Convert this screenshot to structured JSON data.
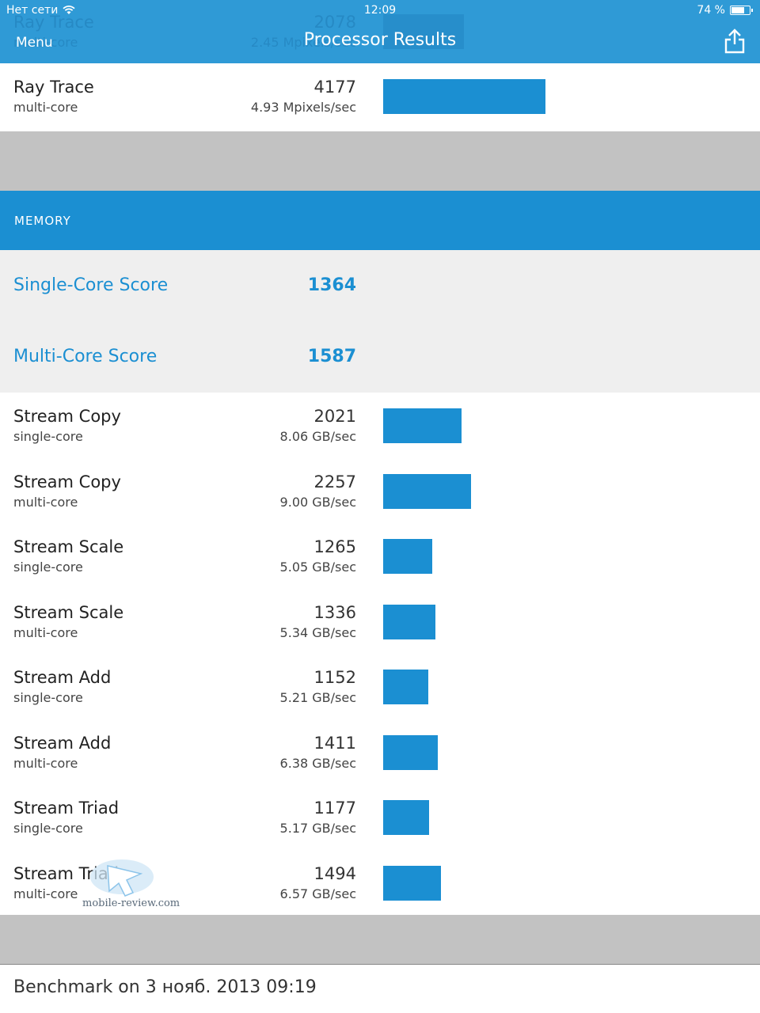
{
  "status_bar": {
    "carrier": "Нет сети",
    "time": "12:09",
    "battery": "74 %",
    "battery_level": 0.74
  },
  "header": {
    "menu_label": "Menu",
    "title": "Processor Results"
  },
  "ghost_row": {
    "title": "Ray Trace",
    "subtitle": "multi-core",
    "score": "2078",
    "rate": "2.45 Mpixels/sec",
    "score_value": 2078
  },
  "top_row": {
    "title": "Ray Trace",
    "subtitle": "multi-core",
    "score": "4177",
    "rate": "4.93 Mpixels/sec",
    "score_value": 4177
  },
  "section": {
    "label": "MEMORY"
  },
  "summary": {
    "single_label": "Single-Core Score",
    "single_value": "1364",
    "multi_label": "Multi-Core Score",
    "multi_value": "1587"
  },
  "rows": [
    {
      "title": "Stream Copy",
      "subtitle": "single-core",
      "score": "2021",
      "rate": "8.06 GB/sec",
      "score_value": 2021
    },
    {
      "title": "Stream Copy",
      "subtitle": "multi-core",
      "score": "2257",
      "rate": "9.00 GB/sec",
      "score_value": 2257
    },
    {
      "title": "Stream Scale",
      "subtitle": "single-core",
      "score": "1265",
      "rate": "5.05 GB/sec",
      "score_value": 1265
    },
    {
      "title": "Stream Scale",
      "subtitle": "multi-core",
      "score": "1336",
      "rate": "5.34 GB/sec",
      "score_value": 1336
    },
    {
      "title": "Stream Add",
      "subtitle": "single-core",
      "score": "1152",
      "rate": "5.21 GB/sec",
      "score_value": 1152
    },
    {
      "title": "Stream Add",
      "subtitle": "multi-core",
      "score": "1411",
      "rate": "6.38 GB/sec",
      "score_value": 1411
    },
    {
      "title": "Stream Triad",
      "subtitle": "single-core",
      "score": "1177",
      "rate": "5.17 GB/sec",
      "score_value": 1177
    },
    {
      "title": "Stream Triad",
      "subtitle": "multi-core",
      "score": "1494",
      "rate": "6.57 GB/sec",
      "score_value": 1494
    }
  ],
  "watermark": {
    "text": "mobile-review.com"
  },
  "footer": {
    "text": "Benchmark on 3 нояб. 2013 09:19"
  },
  "colors": {
    "accent": "#1b8fd2",
    "header": "#2f9ad6",
    "band": "#c2c2c2",
    "summary_bg": "#efefef"
  }
}
